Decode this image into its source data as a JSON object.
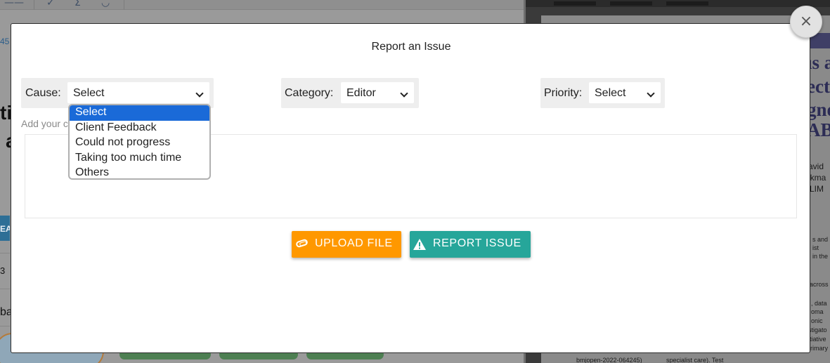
{
  "background_app": {
    "left_fragments": {
      "number": "45",
      "big_ti": "ti",
      "big_a": "a",
      "blue_tab": "EA",
      "row_number": "3",
      "ba": "ba"
    },
    "pdf": {
      "title_lines": [
        "ıs a",
        "ecti",
        "gnos",
        "ABI"
      ],
      "authors": [
        "avid",
        "ekma",
        "g LIM"
      ],
      "fragments": [
        "s and",
        "ist",
        "in the",
        "across",
        ", data",
        "oma",
        "onic",
        "stigato",
        "tiative",
        "primary"
      ],
      "footer_left": "bmjopen-2022-064245)",
      "footer_right": "specialist care). Test"
    }
  },
  "modal": {
    "title": "Report an Issue",
    "close_icon": "×",
    "cause": {
      "label": "Cause:",
      "value": "Select",
      "options": [
        "Select",
        "Client Feedback",
        "Could not progress",
        "Taking too much time",
        "Others"
      ],
      "highlighted_option": "Select"
    },
    "category": {
      "label": "Category:",
      "value": "Editor"
    },
    "priority": {
      "label": "Priority:",
      "value": "Select"
    },
    "description_label": "Add your c",
    "upload_button": "UPLOAD FILE",
    "report_button": "REPORT ISSUE",
    "colors": {
      "upload": "#ff9800",
      "report": "#26a69a",
      "highlight": "#1a6ad8"
    }
  }
}
